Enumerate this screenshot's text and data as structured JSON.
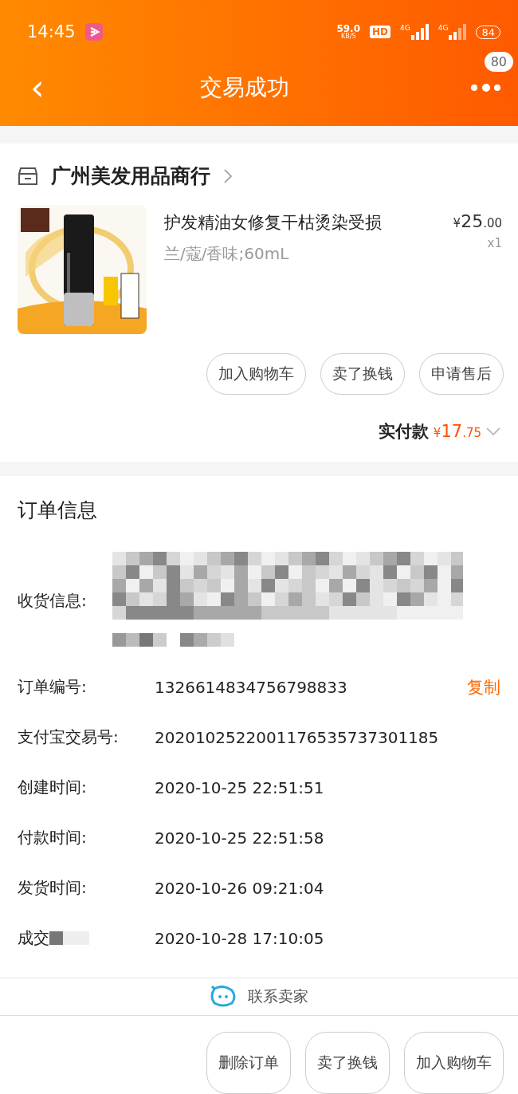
{
  "status_bar": {
    "time": "14:45",
    "speed_value": "59.0",
    "speed_unit": "KB/S",
    "hd": "HD",
    "network_1": "4G",
    "network_2": "4G",
    "battery": "84"
  },
  "header": {
    "back": "‹",
    "title": "交易成功",
    "badge": "80"
  },
  "shop": {
    "name": "广州美发用品商行"
  },
  "product": {
    "kind": "picture",
    "title": "护发精油女修复干枯烫染受损",
    "sku": "兰/蔻/香味;60mL",
    "price_symbol": "¥",
    "price_int": "25",
    "price_dec": ".00",
    "quantity": "x1"
  },
  "item_actions": [
    "加入购物车",
    "卖了换钱",
    "申请售后"
  ],
  "payment": {
    "label": "实付款",
    "symbol": "¥",
    "amount_int": "17",
    "amount_dec": ".75"
  },
  "order_info": {
    "title": "订单信息",
    "address_label": "收货信息:",
    "rows": [
      {
        "label": "订单编号:",
        "value": "1326614834756798833",
        "action": "复制"
      },
      {
        "label": "支付宝交易号:",
        "value": "2020102522001176535737301185"
      },
      {
        "label": "创建时间:",
        "value": "2020-10-25 22:51:51"
      },
      {
        "label": "付款时间:",
        "value": "2020-10-25 22:51:58"
      },
      {
        "label": "发货时间:",
        "value": "2020-10-26 09:21:04"
      },
      {
        "label": "成交",
        "value": "2020-10-28 17:10:05",
        "redacted": true
      }
    ]
  },
  "contact": {
    "label": "联系卖家"
  },
  "bottom_actions": [
    "删除订单",
    "卖了换钱",
    "加入购物车"
  ]
}
